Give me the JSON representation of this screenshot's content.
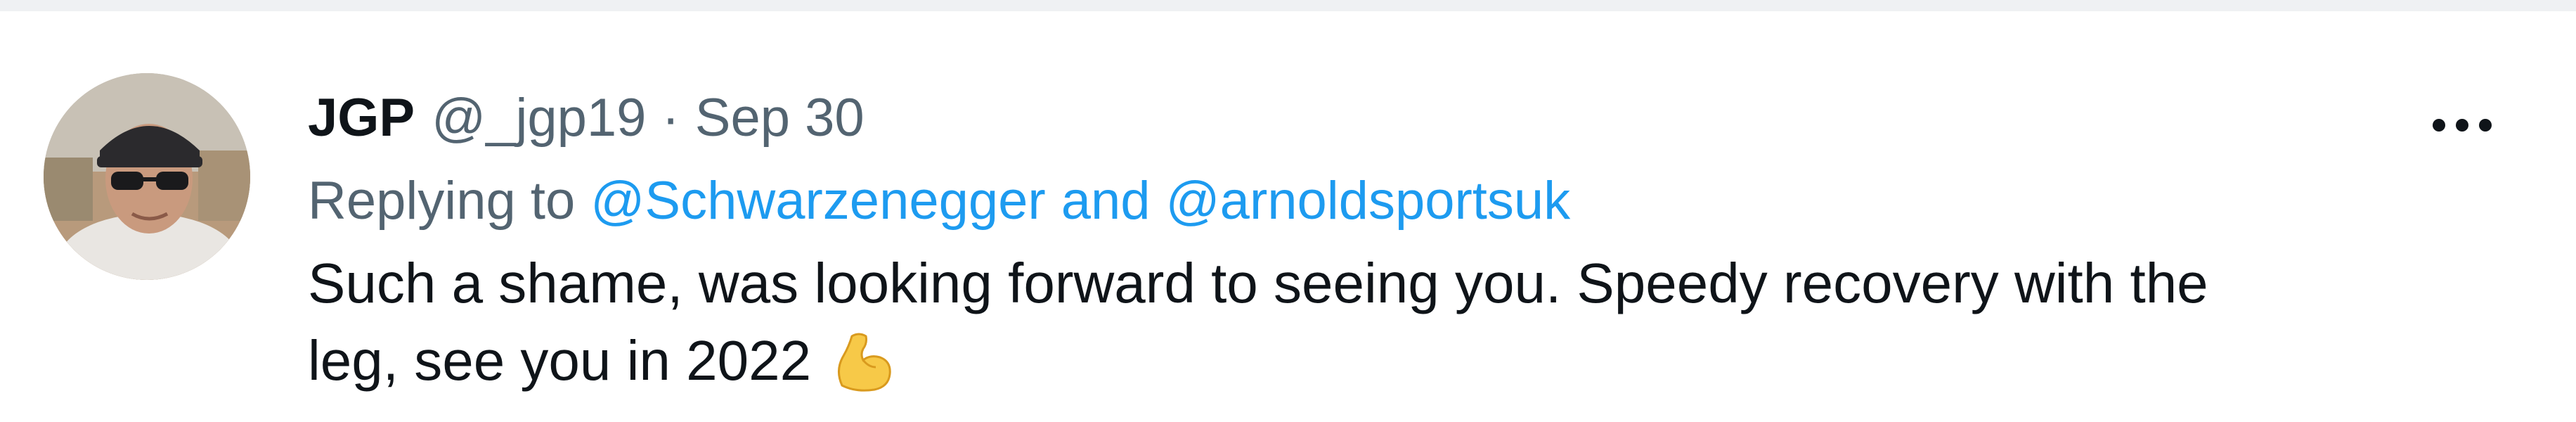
{
  "tweet": {
    "display_name": "JGP",
    "handle": "@_jgp19",
    "separator": "·",
    "date": "Sep 30",
    "more_label": "···",
    "replying_to": {
      "prefix": "Replying to",
      "mention_1": "@Schwarzenegger",
      "conjunction": "and",
      "mention_2": "@arnoldsportsuk"
    },
    "text_line_1": "Such a shame, was looking forward to seeing you. Speedy recovery with the",
    "text_line_2": "leg, see you in 2022",
    "emoji": "flexed-biceps-emoji"
  },
  "colors": {
    "text_primary": "#0f1419",
    "text_secondary": "#536471",
    "link": "#1d9bf0",
    "divider": "#eff1f3"
  }
}
